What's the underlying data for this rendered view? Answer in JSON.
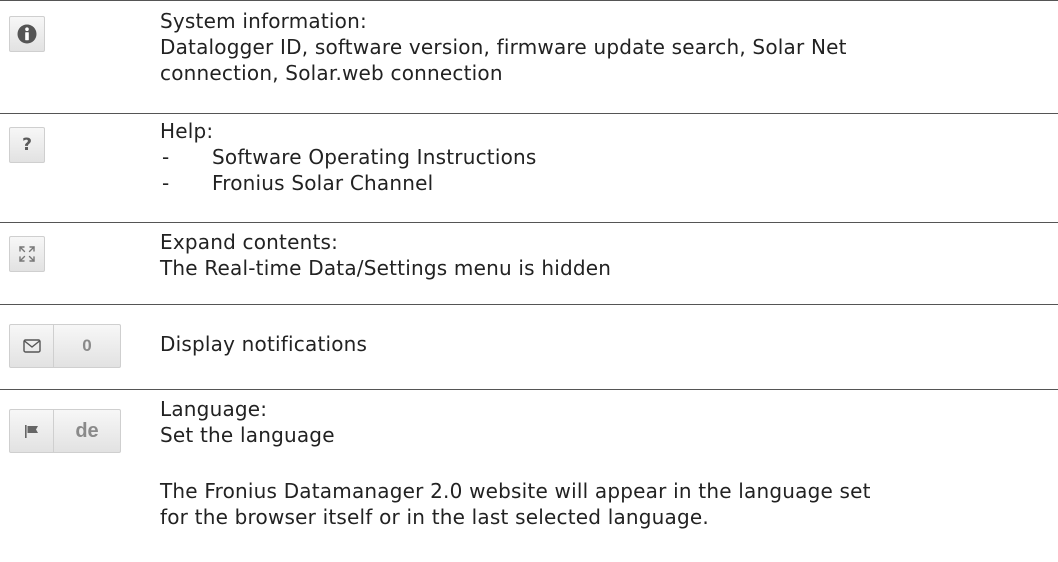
{
  "rows": [
    {
      "icon": "info-icon",
      "heading": "System information:",
      "lines": [
        "Datalogger ID, software version, firmware update search, Solar Net",
        "connection, Solar.web connection"
      ]
    },
    {
      "icon": "help-icon",
      "icon_glyph": "?",
      "heading": "Help:",
      "bullet_dash": "-",
      "bullets": [
        "Software Operating Instructions",
        "Fronius Solar Channel"
      ]
    },
    {
      "icon": "expand-icon",
      "heading": "Expand contents:",
      "lines": [
        "The Real-time Data/Settings menu is hidden"
      ]
    },
    {
      "icon": "envelope-icon",
      "button_value": "0",
      "heading": "Display notifications"
    },
    {
      "icon": "flag-icon",
      "button_value": "de",
      "heading": "Language:",
      "lines": [
        "Set the language"
      ],
      "note_lines": [
        "The Fronius Datamanager 2.0 website will appear in the language set",
        "for the browser itself or in the last selected language."
      ]
    }
  ]
}
